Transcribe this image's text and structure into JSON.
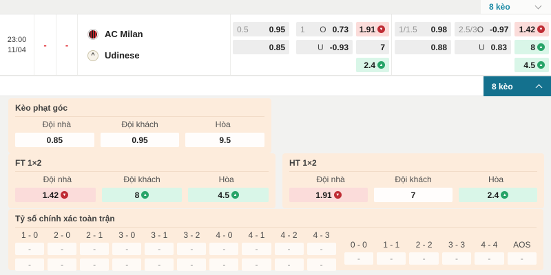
{
  "header": {
    "keo_label": "8 kèo"
  },
  "expand_button": {
    "label": "8 kèo"
  },
  "icons": {
    "trend_down": "▼",
    "trend_up": "▲",
    "udinese_glyph": "^"
  },
  "colors": {
    "teal_button": "#14718e",
    "teal_text": "#1687a3",
    "card_bg": "#fdecdc",
    "pink_box": "#fbdcda",
    "green_box": "#d9f6e8",
    "down_circle": "#bf2c34",
    "up_circle": "#27a468"
  },
  "match": {
    "time": "23:00",
    "date": "11/04",
    "home_score": "-",
    "away_score": "-",
    "home_team": "AC Milan",
    "away_team": "Udinese"
  },
  "odds": [
    {
      "hdp": {
        "line1": "0.5",
        "odds1": "0.95",
        "line2": "",
        "odds2": "0.85"
      },
      "ou": {
        "line1": "1",
        "side1": "O",
        "odds1": "0.73",
        "line2": "",
        "side2": "U",
        "odds2": "-0.93"
      },
      "x12": {
        "v1": "1.91",
        "v2": "7",
        "v3": "2.4"
      }
    },
    {
      "hdp": {
        "line1": "1/1.5",
        "odds1": "0.98",
        "line2": "",
        "odds2": "0.88"
      },
      "ou": {
        "line1": "2.5/3",
        "side1": "O",
        "odds1": "-0.97",
        "line2": "",
        "side2": "U",
        "odds2": "0.83"
      },
      "x12": {
        "v1": "1.42",
        "v2": "8",
        "v3": "4.5"
      }
    }
  ],
  "corner_card": {
    "title": "Kèo phạt góc",
    "headers": [
      "Đội nhà",
      "Đội khách",
      "Hòa"
    ],
    "values": [
      "0.85",
      "0.95",
      "9.5"
    ]
  },
  "ft_card": {
    "title": "FT 1×2",
    "headers": [
      "Đội nhà",
      "Đội khách",
      "Hòa"
    ],
    "values": [
      "1.42",
      "8",
      "4.5"
    ]
  },
  "ht_card": {
    "title": "HT 1×2",
    "headers": [
      "Đội nhà",
      "Đội khách",
      "Hòa"
    ],
    "values": [
      "1.91",
      "7",
      "2.4"
    ]
  },
  "score_card": {
    "title": "Tỷ số chính xác toàn trận",
    "group1": [
      "1 - 0",
      "2 - 0",
      "2 - 1",
      "3 - 0",
      "3 - 1",
      "3 - 2",
      "4 - 0",
      "4 - 1",
      "4 - 2",
      "4 - 3"
    ],
    "group2": [
      "0 - 0",
      "1 - 1",
      "2 - 2",
      "3 - 3",
      "4 - 4",
      "AOS"
    ],
    "dash": "-"
  }
}
